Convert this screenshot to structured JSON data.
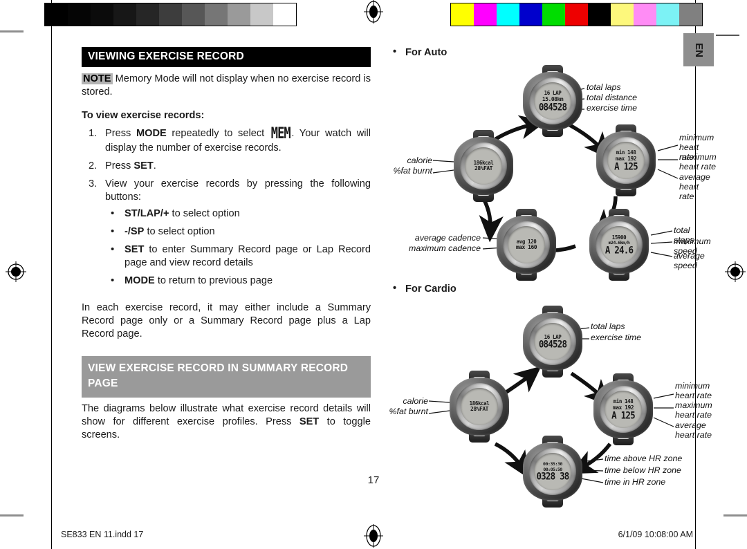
{
  "page": {
    "number": "17",
    "language_tab": "EN"
  },
  "footer": {
    "file": "SE833 EN 11.indd   17",
    "timestamp": "6/1/09   10:08:00 AM"
  },
  "left_column": {
    "heading_main": "VIEWING EXERCISE RECORD",
    "note_tag": "NOTE",
    "note_text": " Memory Mode will not display when no exercise record is stored.",
    "sub_heading": "To view exercise records:",
    "steps": [
      {
        "num": "1.",
        "pre": "Press ",
        "bold1": "MODE",
        "mid": " repeatedly to select ",
        "icon": "MEM",
        "post": ". Your watch will display the number of exercise records."
      },
      {
        "num": "2.",
        "pre": "Press ",
        "bold1": "SET",
        "mid": "",
        "icon": "",
        "post": "."
      },
      {
        "num": "3.",
        "pre": "View your exercise records by pressing the following buttons:",
        "bold1": "",
        "mid": "",
        "icon": "",
        "post": ""
      }
    ],
    "bullets": [
      {
        "bold": "ST/LAP/+",
        "text": " to select option"
      },
      {
        "bold": "-/SP",
        "text": " to select option"
      },
      {
        "bold": "SET",
        "text": " to enter Summary Record page or Lap Record page and view record details"
      },
      {
        "bold": "MODE",
        "text": " to return to previous page"
      }
    ],
    "paragraph": "In each exercise record, it may either include a Summary Record page only or a Summary Record page plus a Lap Record page.",
    "heading_gray": "VIEW EXERCISE RECORD IN SUMMARY RECORD PAGE",
    "closing_pre": "The diagrams below illustrate what exercise record details will show for different exercise profiles. Press ",
    "closing_bold": "SET",
    "closing_post": " to toggle screens."
  },
  "right_column": {
    "auto": {
      "bullet": "•",
      "title": "For Auto",
      "watches": [
        {
          "id": "summary-lap-distance-time",
          "lcd": {
            "l1": "16  LAP",
            "l2": "15.08km",
            "l3": "084528"
          },
          "callouts_right": [
            "total laps",
            "total distance",
            "exercise time"
          ],
          "callouts_left": []
        },
        {
          "id": "heart-rate",
          "lcd": {
            "l1": "min  148",
            "l2": "max  192",
            "l3": "A 125"
          },
          "callouts_right": [
            "minimum\nheart rate",
            "maximum\nheart rate",
            "average\nheart rate"
          ],
          "callouts_left": []
        },
        {
          "id": "steps-speed",
          "lcd": {
            "l1": "15900",
            "l2": "m24.6km/h",
            "l3": "A 24.6"
          },
          "callouts_right": [
            "total steps",
            "maximum speed",
            "average speed"
          ],
          "callouts_left": []
        },
        {
          "id": "cadence",
          "lcd": {
            "l1": "avg  120",
            "l2": "max  160",
            "l3": ""
          },
          "callouts_right": [],
          "callouts_left": [
            "average cadence",
            "maximum cadence"
          ]
        },
        {
          "id": "calorie-fat",
          "lcd": {
            "l1": "186kcal",
            "l2": "28%FAT",
            "l3": ""
          },
          "callouts_right": [],
          "callouts_left": [
            "calorie",
            "%fat burnt"
          ]
        }
      ]
    },
    "cardio": {
      "bullet": "•",
      "title": "For Cardio",
      "watches": [
        {
          "id": "summary-lap-time",
          "lcd": {
            "l1": "16  LAP",
            "l2": "",
            "l3": "084528"
          },
          "callouts_right": [
            "total laps",
            "exercise time"
          ],
          "callouts_left": []
        },
        {
          "id": "heart-rate",
          "lcd": {
            "l1": "min  148",
            "l2": "max  192",
            "l3": "A 125"
          },
          "callouts_right": [
            "minimum\nheart rate",
            "maximum\nheart rate",
            "average\nheart rate"
          ],
          "callouts_left": []
        },
        {
          "id": "hr-zone-times",
          "lcd": {
            "l1": "00:35:30",
            "l2": "00:05:50",
            "l3": "0328 38"
          },
          "callouts_right": [
            "time above HR zone",
            "time below HR zone",
            "time in HR zone"
          ],
          "callouts_left": []
        },
        {
          "id": "calorie-fat",
          "lcd": {
            "l1": "186kcal",
            "l2": "28%FAT",
            "l3": ""
          },
          "callouts_right": [],
          "callouts_left": [
            "calorie",
            "%fat burnt"
          ]
        }
      ]
    }
  },
  "calibration": {
    "grayscale_swatches": [
      "#000000",
      "#050505",
      "#0b0b0b",
      "#171717",
      "#262626",
      "#3d3d3d",
      "#575757",
      "#767676",
      "#9a9a9a",
      "#c8c8c8",
      "#ffffff"
    ],
    "color_swatches": [
      "#ffff00",
      "#ff00ff",
      "#00ffff",
      "#0000cc",
      "#00dd00",
      "#ee0000",
      "#000000",
      "#fdf87c",
      "#ff8cf5",
      "#7cf2f5",
      "#808080"
    ]
  }
}
